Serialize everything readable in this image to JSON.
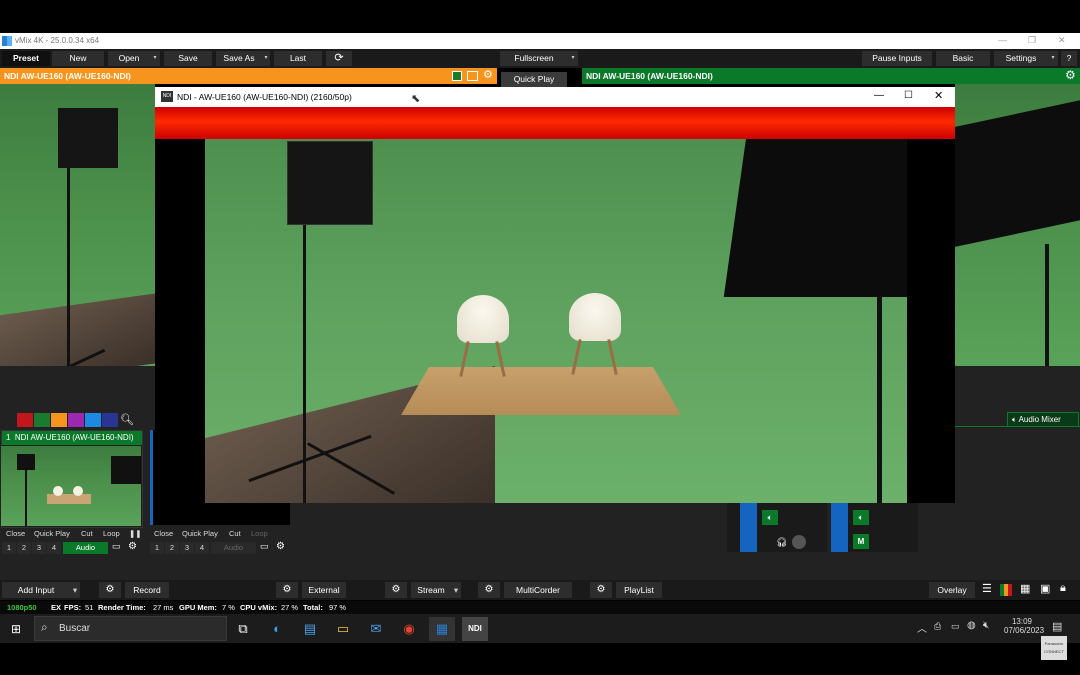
{
  "app": {
    "title": "vMix 4K - 25.0.0.34 x64",
    "window_controls": [
      "—",
      "❐",
      "✕"
    ]
  },
  "menu": {
    "preset": "Preset",
    "new": "New",
    "open": "Open",
    "save": "Save",
    "save_as": "Save As",
    "last": "Last",
    "fullscreen": "Fullscreen",
    "pause_inputs": "Pause Inputs",
    "basic": "Basic",
    "settings": "Settings",
    "help": "?"
  },
  "preview": {
    "title": "NDI AW-UE160 (AW-UE160-NDI)",
    "quick_play": "Quick Play"
  },
  "program": {
    "title": "NDI AW-UE160 (AW-UE160-NDI)"
  },
  "ndi_window": {
    "title": "NDI - AW-UE160 (AW-UE160-NDI) (2160/50p)"
  },
  "colors": {
    "swatches": [
      "#c0161c",
      "#1b7a2d",
      "#f7941d",
      "#9c27b0",
      "#1e88e5",
      "#283593"
    ],
    "accent_orange": "#f7941d",
    "accent_green": "#0a7a2a",
    "accent_blue": "#1565c0"
  },
  "input1": {
    "number": "1",
    "title": "NDI AW-UE160 (AW-UE160-NDI)",
    "close": "Close",
    "quick_play": "Quick Play",
    "cut": "Cut",
    "loop": "Loop",
    "pause_icon": "❚❚",
    "nums": [
      "1",
      "2",
      "3",
      "4"
    ],
    "audio": "Audio"
  },
  "input2": {
    "close": "Close",
    "quick_play": "Quick Play",
    "cut": "Cut",
    "loop": "Loop",
    "nums": [
      "1",
      "2",
      "3",
      "4"
    ],
    "audio": "Audio"
  },
  "audio_mixer": {
    "label": "Audio Mixer",
    "mute": "M"
  },
  "bottom": {
    "add_input": "Add Input",
    "record": "Record",
    "external": "External",
    "stream": "Stream",
    "multicorder": "MultiCorder",
    "playlist": "PlayList",
    "overlay": "Overlay"
  },
  "status": {
    "format": "1080p50",
    "ex": "EX",
    "fps_label": "FPS:",
    "fps": "51",
    "render_label": "Render Time:",
    "render": "27 ms",
    "gpu_label": "GPU Mem:",
    "gpu": "7 %",
    "cpu_label": "CPU vMix:",
    "cpu": "27 %",
    "total_label": "Total:",
    "total": "97 %"
  },
  "taskbar": {
    "search": "Buscar",
    "time": "13:09",
    "date": "07/06/2023",
    "ndi": "NDI"
  },
  "watermark": {
    "text": "Panasonic CONNECT"
  }
}
